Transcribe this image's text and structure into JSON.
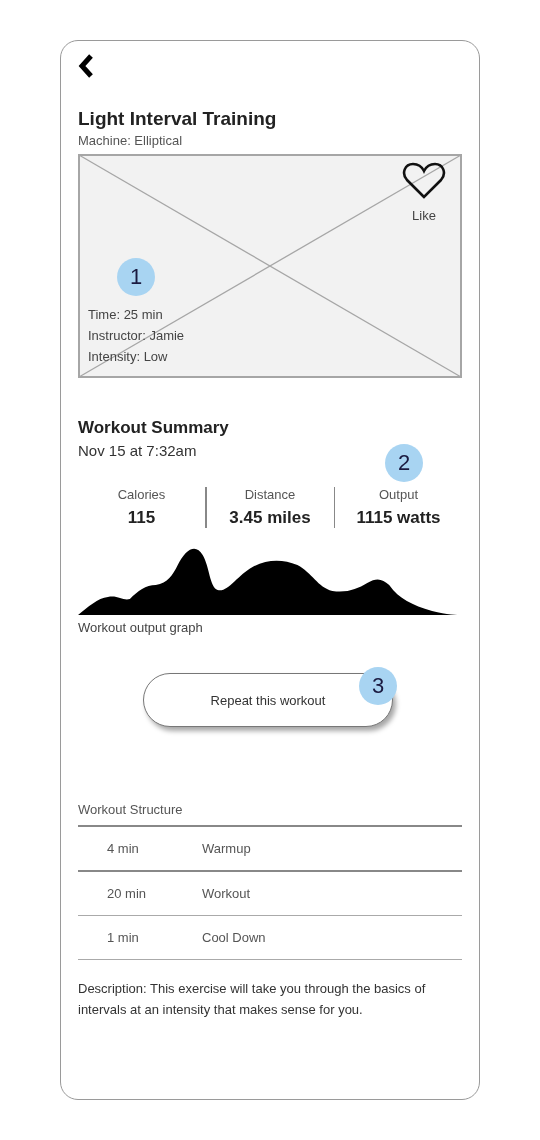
{
  "title": "Light Interval Training",
  "machine": "Machine: Elliptical",
  "hero": {
    "like": "Like",
    "marker": "1",
    "details": [
      "Time: 25 min",
      "Instructor: Jamie",
      "Intensity: Low"
    ]
  },
  "summary": {
    "title": "Workout Summary",
    "date": "Nov 15 at 7:32am",
    "marker": "2",
    "stats": [
      {
        "label": "Calories",
        "value": "115"
      },
      {
        "label": "Distance",
        "value": "3.45 miles"
      },
      {
        "label": "Output",
        "value": "1115 watts"
      }
    ],
    "graph_caption": "Workout output graph"
  },
  "repeat_button": {
    "label": "Repeat this workout",
    "marker": "3"
  },
  "structure": {
    "title": "Workout Structure",
    "rows": [
      {
        "duration": "4 min",
        "phase": "Warmup"
      },
      {
        "duration": "20 min",
        "phase": "Workout"
      },
      {
        "duration": "1 min",
        "phase": "Cool Down"
      }
    ]
  },
  "description": "Description: This exercise will take you through the basics of intervals at an intensity that makes sense for you."
}
